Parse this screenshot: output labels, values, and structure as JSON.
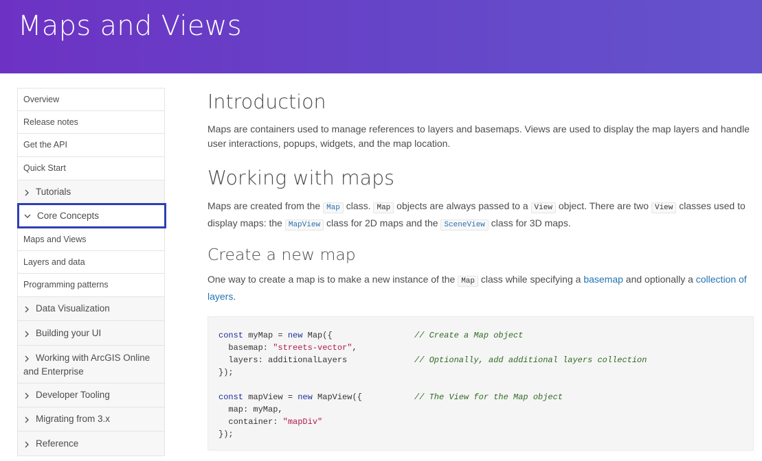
{
  "page": {
    "title": "Maps and Views"
  },
  "sidebar": {
    "items": [
      {
        "label": "Overview",
        "kind": "leaf"
      },
      {
        "label": "Release notes",
        "kind": "leaf"
      },
      {
        "label": "Get the API",
        "kind": "leaf"
      },
      {
        "label": "Quick Start",
        "kind": "leaf"
      },
      {
        "label": "Tutorials",
        "kind": "group",
        "state": "collapsed"
      },
      {
        "label": "Core Concepts",
        "kind": "group",
        "state": "expanded",
        "selected": true
      },
      {
        "label": "Maps and Views",
        "kind": "leaf"
      },
      {
        "label": "Layers and data",
        "kind": "leaf"
      },
      {
        "label": "Programming patterns",
        "kind": "leaf"
      },
      {
        "label": "Data Visualization",
        "kind": "group",
        "state": "collapsed"
      },
      {
        "label": "Building your UI",
        "kind": "group",
        "state": "collapsed"
      },
      {
        "label": "Working with ArcGIS Online",
        "label2": "and Enterprise",
        "kind": "group",
        "state": "collapsed"
      },
      {
        "label": "Developer Tooling",
        "kind": "group",
        "state": "collapsed"
      },
      {
        "label": "Migrating from 3.x",
        "kind": "group",
        "state": "collapsed"
      },
      {
        "label": "Reference",
        "kind": "group",
        "state": "collapsed"
      }
    ]
  },
  "content": {
    "intro": {
      "heading": "Introduction",
      "text": "Maps are containers used to manage references to layers and basemaps. Views are used to display the map layers and handle user interactions, popups, widgets, and the map location."
    },
    "working": {
      "heading": "Working with maps",
      "t1": "Maps are created from the",
      "c1": "Map",
      "t2": "class.",
      "c2": "Map",
      "t3": "objects are always passed to a",
      "c3": "View",
      "t4": "object. There are two",
      "c4": "View",
      "t5": "classes used to display maps: the",
      "c5": "MapView",
      "t6": "class for 2D maps and the",
      "c6": "SceneView",
      "t7": "class for 3D maps."
    },
    "create": {
      "heading": "Create a new map",
      "t1": "One way to create a map is to make a new instance of the",
      "c1": "Map",
      "t2": "class while specifying a",
      "link1": "basemap",
      "t3": "and optionally a",
      "link2": "collection of layers",
      "t4": "."
    },
    "code": {
      "l1_kw": "const",
      "l1_a": " myMap = ",
      "l1_kw2": "new",
      "l1_b": " Map({",
      "l1_cm": "// Create a Map object",
      "l2_a": "  basemap: ",
      "l2_str": "\"streets-vector\"",
      "l2_b": ",",
      "l3_a": "  layers: additionalLayers",
      "l3_cm": "// Optionally, add additional layers collection",
      "l4_a": "});",
      "l5_kw": "const",
      "l5_a": " mapView = ",
      "l5_kw2": "new",
      "l5_b": " MapView({",
      "l5_cm": "// The View for the Map object",
      "l6_a": "  map: myMap,",
      "l7_a": "  container: ",
      "l7_str": "\"mapDiv\"",
      "l8_a": "});"
    }
  },
  "colors": {
    "banner_start": "#6d32c4",
    "banner_end": "#6553cc",
    "selection_border": "#2e3eb4",
    "link": "#2474b2",
    "code_keyword": "#1d2f9b",
    "code_string": "#b0194a",
    "code_comment": "#2e6b23"
  }
}
